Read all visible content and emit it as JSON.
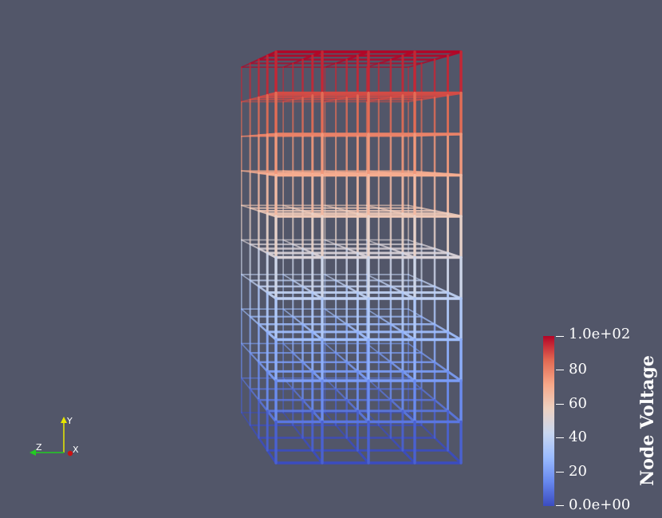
{
  "colorbar": {
    "title": "Node Voltage",
    "labels": [
      "1.0e+02",
      "80",
      "60",
      "40",
      "20",
      "0.0e+00"
    ],
    "values": [
      100,
      80,
      60,
      40,
      20,
      0
    ],
    "range": [
      0,
      100
    ],
    "colormap": [
      "#3b4cc0",
      "#6788ee",
      "#9abbff",
      "#c9d7f0",
      "#edd1c2",
      "#f7a889",
      "#e26952",
      "#b40426"
    ]
  },
  "axes_widget": {
    "y_label": "Y",
    "z_label": "Z",
    "x_label": "X",
    "y_color": "#e8e800",
    "z_color": "#22cc22",
    "x_color": "#cc1111"
  },
  "model": {
    "colored_by": "Node Voltage",
    "levels": 10,
    "background": "#525669"
  }
}
